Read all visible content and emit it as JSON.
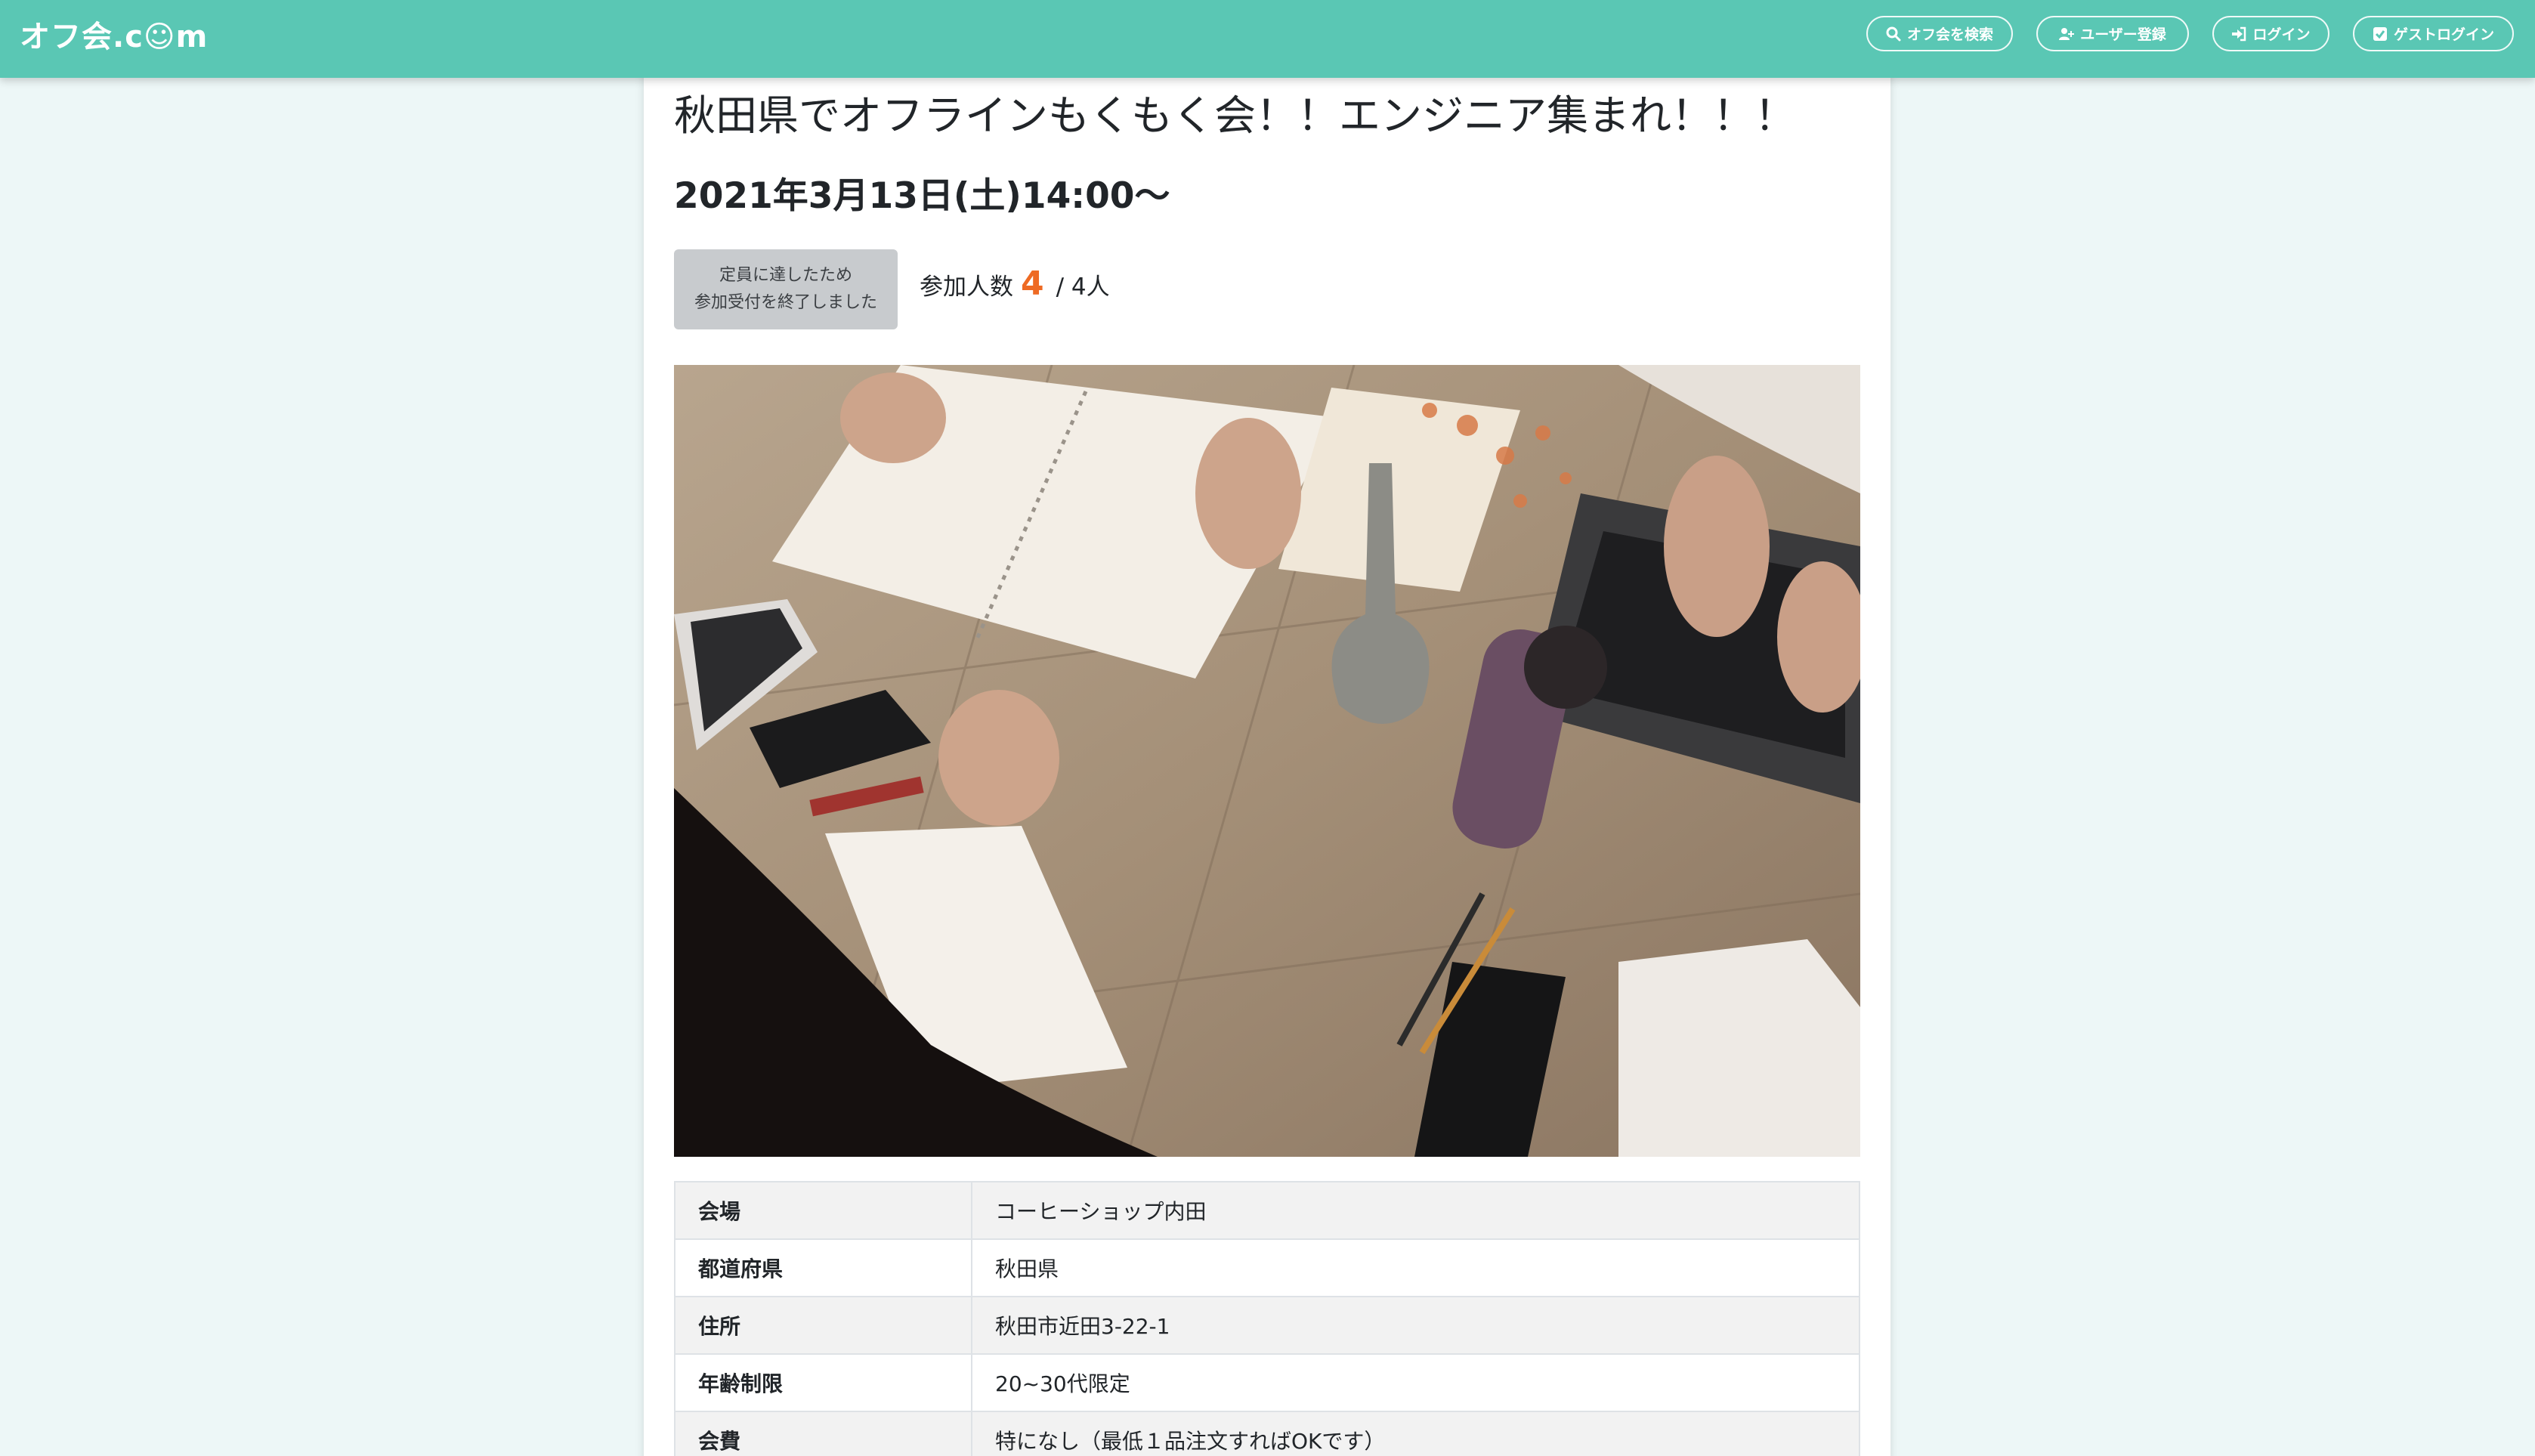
{
  "header": {
    "brand": "オフ会.c☺m",
    "nav": {
      "search": "オフ会を検索",
      "register": "ユーザー登録",
      "login": "ログイン",
      "guest_login": "ゲストログイン"
    }
  },
  "event": {
    "title": "秋田県でオフラインもくもく会！！エンジニア集まれ！！！",
    "datetime": "2021年3月13日(土)14:00〜",
    "status_badge": {
      "line1": "定員に達したため",
      "line2": "参加受付を終了しました"
    },
    "participants": {
      "label": "参加人数",
      "count": "4",
      "capacity": "/ 4人"
    }
  },
  "details": [
    {
      "label": "会場",
      "value": "コーヒーショップ内田"
    },
    {
      "label": "都道府県",
      "value": "秋田県"
    },
    {
      "label": "住所",
      "value": "秋田市近田3-22-1"
    },
    {
      "label": "年齢制限",
      "value": "20~30代限定"
    },
    {
      "label": "会費",
      "value": "特になし（最低１品注文すればOKです）"
    }
  ],
  "icons": {
    "search": "search-icon",
    "register": "user-plus-icon",
    "login": "sign-in-icon",
    "guest_login": "check-square-icon"
  },
  "colors": {
    "header": "#5ac7b4",
    "accent_count": "#ee6a23",
    "badge": "#c8cbce",
    "background": "#edf7f7"
  }
}
